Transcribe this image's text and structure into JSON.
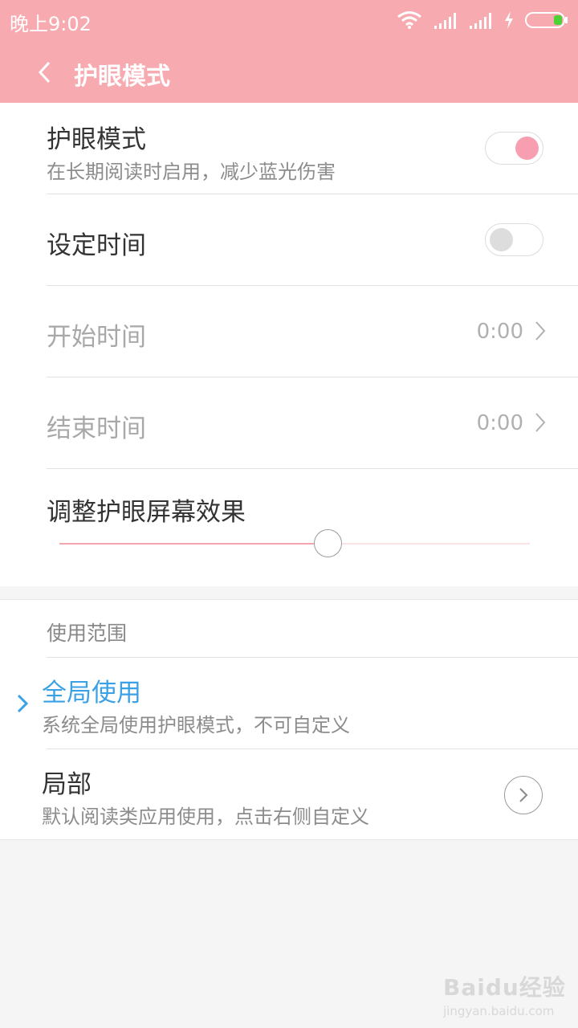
{
  "status_bar": {
    "time": "晚上9:02",
    "icons": [
      "wifi-icon",
      "signal-icon",
      "signal-icon",
      "charging-icon",
      "battery-icon"
    ]
  },
  "header": {
    "title": "护眼模式",
    "back_icon": "back-arrow-icon"
  },
  "settings": {
    "eye_mode": {
      "title": "护眼模式",
      "subtitle": "在长期阅读时启用，减少蓝光伤害",
      "enabled": true
    },
    "schedule": {
      "title": "设定时间",
      "enabled": false
    },
    "start_time": {
      "title": "开始时间",
      "value": "0:00"
    },
    "end_time": {
      "title": "结束时间",
      "value": "0:00"
    },
    "effect": {
      "title": "调整护眼屏幕效果",
      "level": 0.57
    }
  },
  "scope": {
    "header": "使用范围",
    "global": {
      "title": "全局使用",
      "subtitle": "系统全局使用护眼模式，不可自定义",
      "selected": true
    },
    "partial": {
      "title": "局部",
      "subtitle": "默认阅读类应用使用，点击右侧自定义",
      "selected": false
    }
  },
  "watermark": {
    "logo": "Baidu经验",
    "url": "jingyan.baidu.com"
  },
  "colors": {
    "accent_pink": "#f7aaaf",
    "switch_on_knob": "#f79fb0",
    "switch_off_knob": "#dddddd",
    "selected_blue": "#3aa1e6"
  }
}
